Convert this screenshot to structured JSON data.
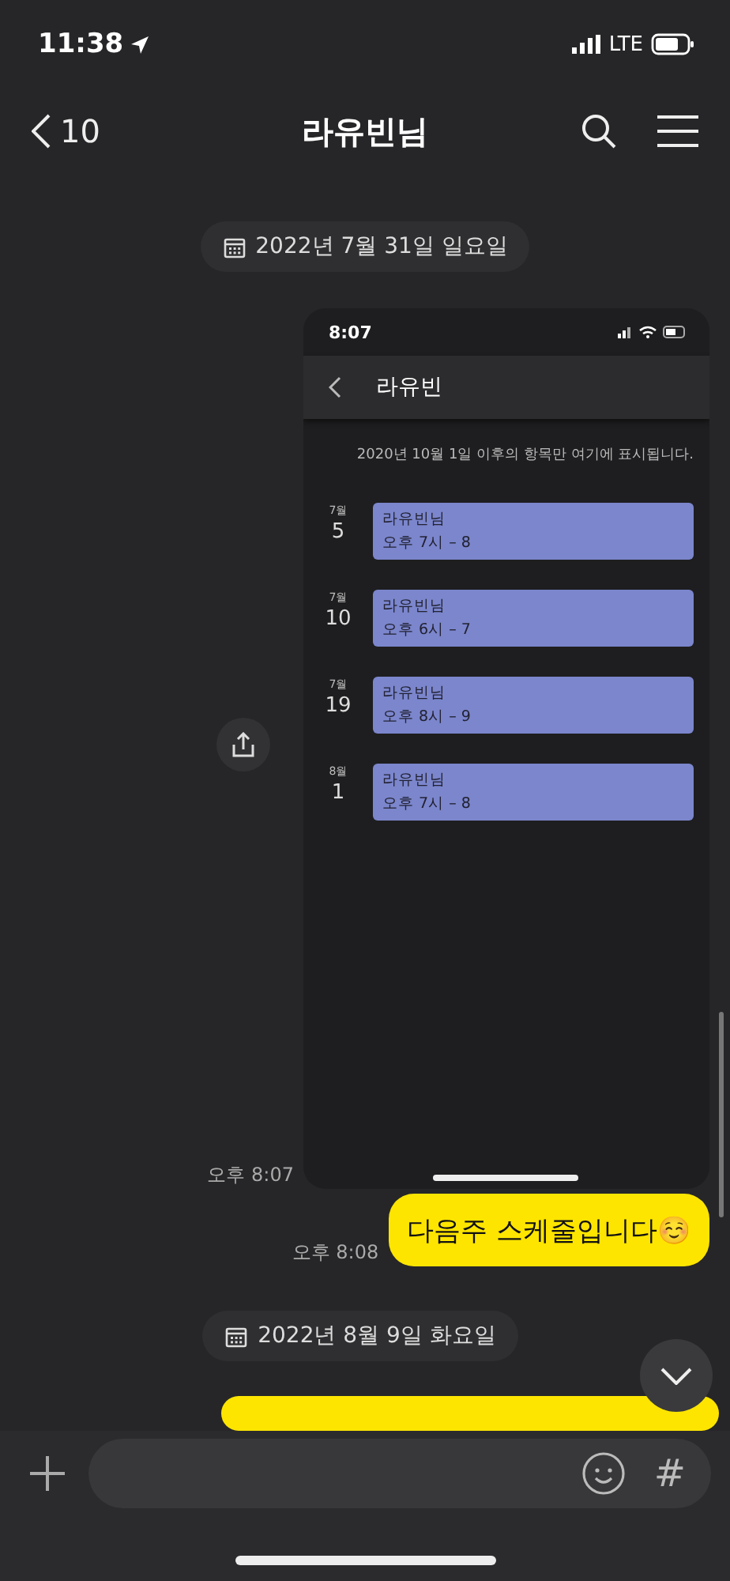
{
  "status_bar": {
    "time": "11:38",
    "network": "LTE"
  },
  "header": {
    "back_count": "10",
    "title": "라유빈님"
  },
  "messages": [
    {
      "kind": "date",
      "text": "2022년 7월 31일 일요일"
    },
    {
      "kind": "image",
      "time": "오후 8:07",
      "screenshot": {
        "time": "8:07",
        "title": "라유빈",
        "notice": "2020년 10월 1일 이후의 항목만 여기에 표시됩니다.",
        "events": [
          {
            "month": "7월",
            "day": "5",
            "title": "라유빈님",
            "when": "오후 7시 – 8",
            "color": "#7b86cc"
          },
          {
            "month": "7월",
            "day": "10",
            "title": "라유빈님",
            "when": "오후 6시 – 7",
            "color": "#7b86cc"
          },
          {
            "month": "7월",
            "day": "19",
            "title": "라유빈님",
            "when": "오후 8시 – 9",
            "color": "#7b86cc"
          },
          {
            "month": "8월",
            "day": "1",
            "title": "라유빈님",
            "when": "오후 7시 – 8",
            "color": "#7b86cc"
          }
        ]
      }
    },
    {
      "kind": "text",
      "time": "오후 8:08",
      "text": "다음주 스케줄입니다☺️"
    },
    {
      "kind": "date",
      "text": "2022년 8월 9일 화요일"
    },
    {
      "kind": "partial"
    }
  ],
  "input_bar": {
    "hashtag": "#"
  }
}
